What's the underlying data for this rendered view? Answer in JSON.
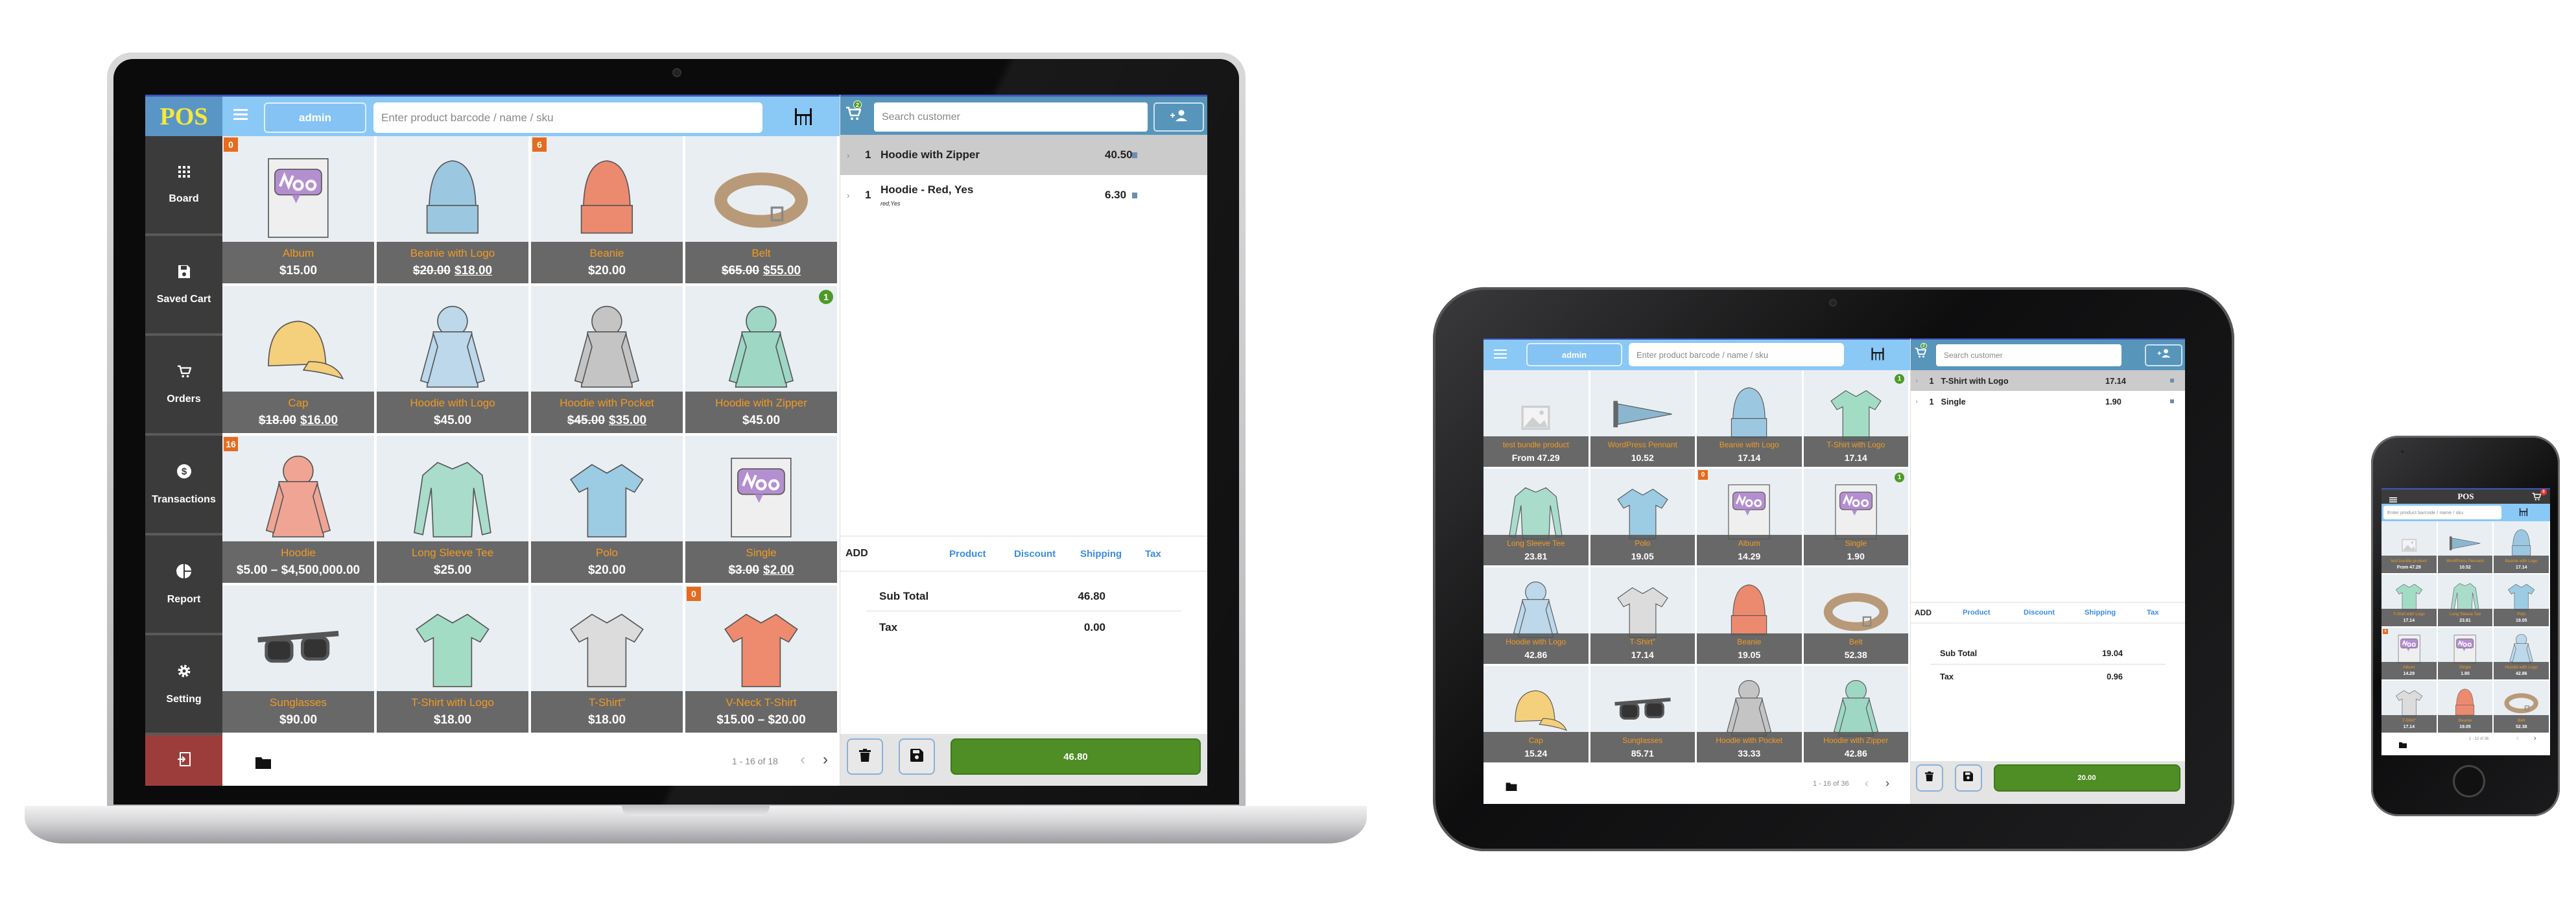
{
  "colors": {
    "header": "#8ac8f6",
    "cart_header": "#5795bb",
    "sidebar": "#3b3b3b",
    "logout": "#9d3d3b",
    "pay": "#4f8d25",
    "badge_orange": "#e56b1f",
    "badge_green": "#4d9a26",
    "product_name": "#f39a1f",
    "link": "#3c8de0"
  },
  "laptop": {
    "logo": "POS",
    "menu_icon": "hamburger-icon",
    "user_button": "admin",
    "search_placeholder": "Enter product barcode / name / sku",
    "table_icon": "table-icon",
    "sidebar": [
      {
        "label": "Board",
        "icon": "grid-icon"
      },
      {
        "label": "Saved Cart",
        "icon": "floppy-icon"
      },
      {
        "label": "Orders",
        "icon": "cart-icon"
      },
      {
        "label": "Transactions",
        "icon": "dollar-icon"
      },
      {
        "label": "Report",
        "icon": "pie-chart-icon"
      },
      {
        "label": "Setting",
        "icon": "gear-icon"
      }
    ],
    "logout_icon": "sign-out-icon",
    "products": [
      {
        "name": "Album",
        "price": "$15.00",
        "badge": "0",
        "badge_type": "orange",
        "image": "album",
        "color": "#b48fd0"
      },
      {
        "name": "Beanie with Logo",
        "regular": "$20.00",
        "price": "$18.00",
        "image": "beanie",
        "color": "#9cc7e0"
      },
      {
        "name": "Beanie",
        "price": "$20.00",
        "badge": "6",
        "badge_type": "orange",
        "image": "beanie",
        "color": "#ec8a70"
      },
      {
        "name": "Belt",
        "regular": "$65.00",
        "price": "$55.00",
        "image": "belt",
        "color": "#b89a78"
      },
      {
        "name": "Cap",
        "regular": "$18.00",
        "price": "$16.00",
        "image": "cap",
        "color": "#f4cf7c"
      },
      {
        "name": "Hoodie with Logo",
        "price": "$45.00",
        "image": "hoodie",
        "color": "#bcd8ea"
      },
      {
        "name": "Hoodie with Pocket",
        "regular": "$45.00",
        "price": "$35.00",
        "image": "hoodie",
        "color": "#c4c4c4"
      },
      {
        "name": "Hoodie with Zipper",
        "price": "$45.00",
        "badge": "1",
        "badge_type": "green",
        "image": "hoodie",
        "color": "#9ed8c4"
      },
      {
        "name": "Hoodie",
        "price": "$5.00 – $4,500,000.00",
        "badge": "16",
        "badge_type": "orange",
        "image": "hoodie",
        "color": "#f0a594"
      },
      {
        "name": "Long Sleeve Tee",
        "price": "$25.00",
        "image": "longsleeve",
        "color": "#a9dcca"
      },
      {
        "name": "Polo",
        "price": "$20.00",
        "image": "tshirt",
        "color": "#9ccbe4"
      },
      {
        "name": "Single",
        "regular": "$3.00",
        "price": "$2.00",
        "image": "album",
        "color": "#b48fd0"
      },
      {
        "name": "Sunglasses",
        "price": "$90.00",
        "image": "sunglasses",
        "color": "#555555"
      },
      {
        "name": "T-Shirt with Logo",
        "price": "$18.00",
        "image": "tshirt",
        "color": "#a3dcc5"
      },
      {
        "name": "T-Shirt\"",
        "price": "$18.00",
        "image": "tshirt",
        "color": "#dcdcdc"
      },
      {
        "name": "V-Neck T-Shirt",
        "price": "$15.00 – $20.00",
        "badge": "0",
        "badge_type": "orange",
        "image": "tshirt",
        "color": "#ee8b6f"
      }
    ],
    "folder_icon": "folder-icon",
    "pagination": "1 - 16 of 18",
    "cart": {
      "count": "2",
      "customer_placeholder": "Search customer",
      "items": [
        {
          "qty": "1",
          "name": "Hoodie with Zipper",
          "price": "40.50",
          "selected": true
        },
        {
          "qty": "1",
          "name": "Hoodie - Red, Yes",
          "meta": "red,Yes",
          "price": "6.30"
        }
      ],
      "add_label": "ADD",
      "add_links": [
        "Product",
        "Discount",
        "Shipping",
        "Tax"
      ],
      "subtotal_label": "Sub Total",
      "subtotal": "46.80",
      "tax_label": "Tax",
      "tax": "0.00",
      "pay_total": "46.80"
    }
  },
  "tablet": {
    "user_button": "admin",
    "search_placeholder": "Enter product barcode / name / sku",
    "products": [
      {
        "name": "test bundle product",
        "price": "From 47.29",
        "image": "placeholder",
        "color": "#cfcfcf"
      },
      {
        "name": "WordPress Pennant",
        "price": "10.52",
        "image": "pennant",
        "color": "#8bb6cf"
      },
      {
        "name": "Beanie with Logo",
        "price": "17.14",
        "image": "beanie",
        "color": "#9cc7e0"
      },
      {
        "name": "T-Shirt with Logo",
        "price": "17.14",
        "badge": "1",
        "badge_type": "green",
        "image": "tshirt",
        "color": "#a3dcc5"
      },
      {
        "name": "Long Sleeve Tee",
        "price": "23.81",
        "image": "longsleeve",
        "color": "#a9dcca"
      },
      {
        "name": "Polo",
        "price": "19.05",
        "image": "tshirt",
        "color": "#9ccbe4"
      },
      {
        "name": "Album",
        "price": "14.29",
        "badge": "0",
        "badge_type": "orange",
        "image": "album",
        "color": "#b48fd0"
      },
      {
        "name": "Single",
        "price": "1.90",
        "badge": "1",
        "badge_type": "green",
        "image": "album",
        "color": "#b48fd0"
      },
      {
        "name": "Hoodie with Logo",
        "price": "42.86",
        "image": "hoodie",
        "color": "#bcd8ea"
      },
      {
        "name": "T-Shirt\"",
        "price": "17.14",
        "image": "tshirt",
        "color": "#dcdcdc"
      },
      {
        "name": "Beanie",
        "price": "19.05",
        "image": "beanie",
        "color": "#ec8a70"
      },
      {
        "name": "Belt",
        "price": "52.38",
        "image": "belt",
        "color": "#b89a78"
      },
      {
        "name": "Cap",
        "price": "15.24",
        "image": "cap",
        "color": "#f4cf7c"
      },
      {
        "name": "Sunglasses",
        "price": "85.71",
        "image": "sunglasses",
        "color": "#555555"
      },
      {
        "name": "Hoodie with Pocket",
        "price": "33.33",
        "image": "hoodie",
        "color": "#c4c4c4"
      },
      {
        "name": "Hoodie with Zipper",
        "price": "42.86",
        "image": "hoodie",
        "color": "#9ed8c4"
      }
    ],
    "pagination": "1 - 16 of 36",
    "cart": {
      "count": "2",
      "customer_placeholder": "Search customer",
      "items": [
        {
          "qty": "1",
          "name": "T-Shirt with Logo",
          "price": "17.14",
          "selected": true
        },
        {
          "qty": "1",
          "name": "Single",
          "price": "1.90"
        }
      ],
      "add_label": "ADD",
      "add_links": [
        "Product",
        "Discount",
        "Shipping",
        "Tax"
      ],
      "subtotal_label": "Sub Total",
      "subtotal": "19.04",
      "tax_label": "Tax",
      "tax": "0.96",
      "pay_total": "20.00"
    }
  },
  "phone": {
    "title": "POS",
    "cart_count": "0",
    "search_placeholder": "Enter product barcode / name / sku",
    "products": [
      {
        "name": "test bundle product",
        "price": "From 47.29",
        "image": "placeholder",
        "color": "#cfcfcf"
      },
      {
        "name": "WordPress Pennant",
        "price": "10.52",
        "image": "pennant",
        "color": "#8bb6cf"
      },
      {
        "name": "Beanie with Logo",
        "price": "17.14",
        "image": "beanie",
        "color": "#9cc7e0"
      },
      {
        "name": "T-Shirt with Logo",
        "price": "17.14",
        "image": "tshirt",
        "color": "#a3dcc5"
      },
      {
        "name": "Long Sleeve Tee",
        "price": "23.81",
        "image": "longsleeve",
        "color": "#a9dcca"
      },
      {
        "name": "Polo",
        "price": "19.05",
        "image": "tshirt",
        "color": "#9ccbe4"
      },
      {
        "name": "Album",
        "price": "14.29",
        "badge": "0",
        "badge_type": "orange",
        "image": "album",
        "color": "#b48fd0"
      },
      {
        "name": "Single",
        "price": "1.90",
        "image": "album",
        "color": "#b48fd0"
      },
      {
        "name": "Hoodie with Logo",
        "price": "42.86",
        "image": "hoodie",
        "color": "#bcd8ea"
      },
      {
        "name": "T-Shirt\"",
        "price": "17.14",
        "image": "tshirt",
        "color": "#dcdcdc"
      },
      {
        "name": "Beanie",
        "price": "19.05",
        "image": "beanie",
        "color": "#ec8a70"
      },
      {
        "name": "Belt",
        "price": "52.38",
        "image": "belt",
        "color": "#b89a78"
      }
    ],
    "pagination": "1 - 12 of 36"
  }
}
